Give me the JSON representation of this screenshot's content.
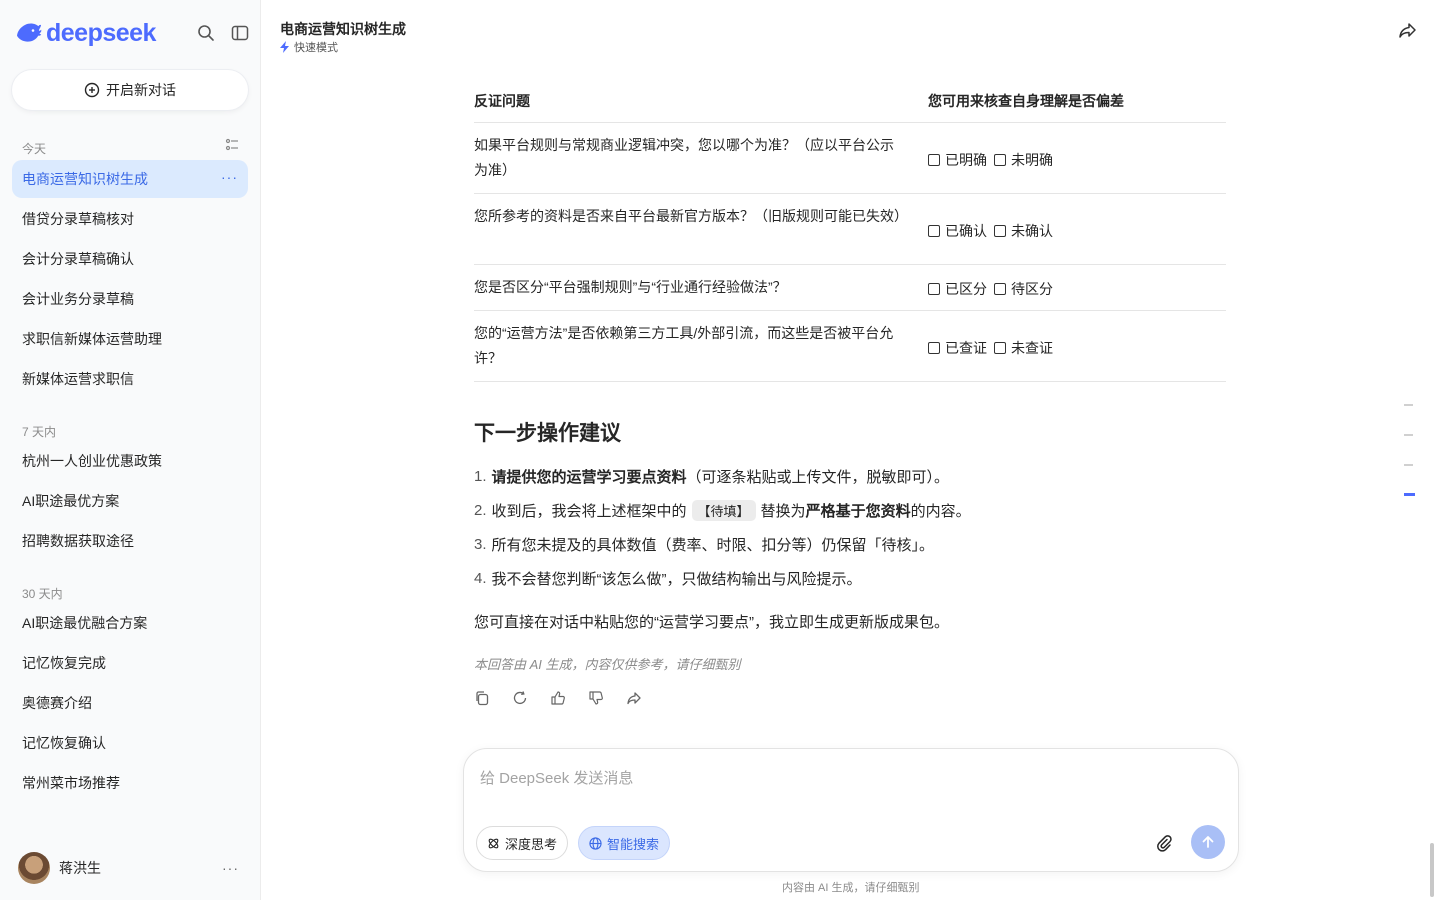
{
  "sidebar": {
    "logo_text": "deepseek",
    "new_chat_label": "开启新对话",
    "groups": {
      "today": "今天",
      "week": "7 天内",
      "month": "30 天内"
    },
    "today_items": [
      "电商运营知识树生成",
      "借贷分录草稿核对",
      "会计分录草稿确认",
      "会计业务分录草稿",
      "求职信新媒体运营助理",
      "新媒体运营求职信"
    ],
    "week_items": [
      "杭州一人创业优惠政策",
      "AI职途最优方案",
      "招聘数据获取途径"
    ],
    "month_items": [
      "AI职途最优融合方案",
      "记忆恢复完成",
      "奥德赛介绍",
      "记忆恢复确认",
      "常州菜市场推荐"
    ],
    "more_dots": "···",
    "user_name": "蒋洪生"
  },
  "header": {
    "title": "电商运营知识树生成",
    "mode": "快速模式"
  },
  "table": {
    "col1": "反证问题",
    "col2": "您可用来核查自身理解是否偏差",
    "rows": [
      {
        "q": "如果平台规则与常规商业逻辑冲突，您以哪个为准？（应以平台公示为准）",
        "a1": "已明确",
        "a2": "未明确"
      },
      {
        "q": "您所参考的资料是否来自平台最新官方版本？（旧版规则可能已失效）",
        "a1": "已确认",
        "a2": "未确认"
      },
      {
        "q": "您是否区分“平台强制规则”与“行业通行经验做法”？",
        "a1": "已区分",
        "a2": "待区分"
      },
      {
        "q": "您的“运营方法”是否依赖第三方工具/外部引流，而这些是否被平台允许？",
        "a1": "已查证",
        "a2": "未查证"
      }
    ]
  },
  "content": {
    "heading": "下一步操作建议",
    "s1_num": "1.",
    "s1_bold": "请提供您的运营学习要点资料",
    "s1_rest": "（可逐条粘贴或上传文件，脱敏即可）。",
    "s2_num": "2.",
    "s2_pre": "收到后，我会将上述框架中的",
    "s2_code": "【待填】",
    "s2_mid": "替换为",
    "s2_bold": "严格基于您资料",
    "s2_post": "的内容。",
    "s3_num": "3.",
    "s3": "所有您未提及的具体数值（费率、时限、扣分等）仍保留「待核」。",
    "s4_num": "4.",
    "s4": "我不会替您判断“该怎么做”，只做结构输出与风险提示。",
    "para": "您可直接在对话中粘贴您的“运营学习要点”，我立即生成更新版成果包。",
    "disclaimer": "本回答由 AI 生成，内容仅供参考，请仔细甄别"
  },
  "composer": {
    "placeholder": "给 DeepSeek 发送消息",
    "deep_think": "深度思考",
    "smart_search": "智能搜索",
    "footer_note": "内容由 AI 生成，请仔细甄别"
  },
  "colors": {
    "brand": "#4d6bfe",
    "active_bg": "#dbeafe"
  }
}
